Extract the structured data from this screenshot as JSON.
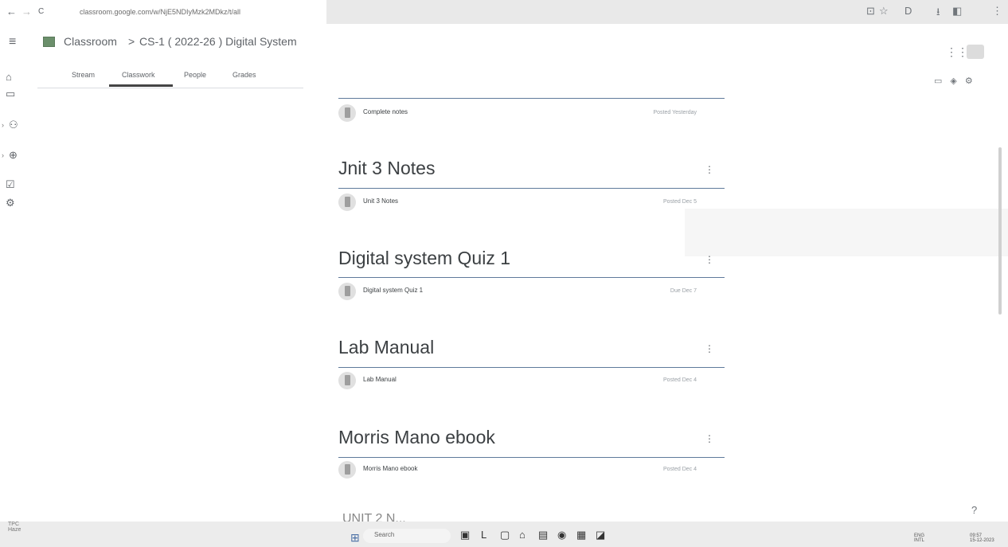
{
  "browser": {
    "back": "←",
    "forward": "→",
    "reload": "C",
    "url": "classroom.google.com/w/NjE5NDIyMzk2MDkz/t/all",
    "extensions": [
      "⊡",
      "☆",
      "D",
      "⭳",
      "◧",
      "⋮"
    ]
  },
  "header": {
    "menu": "≡",
    "app_name": "Classroom",
    "separator": ">",
    "class_name": "CS-1 ( 2022-26 ) Digital System",
    "apps": "⋮⋮"
  },
  "rail": {
    "home": "⌂",
    "calendar": "▭",
    "enrolled": "⚇",
    "teaching": "⊕",
    "todo": "☑",
    "settings": "⚙",
    "caret": "›"
  },
  "tabs": [
    "Stream",
    "Classwork",
    "People",
    "Grades"
  ],
  "tab_active": "Classwork",
  "toolbar": {
    "calendar": "▭",
    "drive": "◈",
    "settings": "⚙"
  },
  "items": {
    "complete": {
      "title": "Complete notes",
      "meta": "Posted Yesterday"
    },
    "unit3": {
      "title": "Unit 3 Notes",
      "meta": "Posted Dec 5"
    },
    "quiz": {
      "title": "Digital system Quiz 1",
      "meta": "Due Dec 7"
    },
    "lab": {
      "title": "Lab Manual",
      "meta": "Posted Dec 4"
    },
    "ebook": {
      "title": "Morris Mano ebook",
      "meta": "Posted Dec 4"
    }
  },
  "topics": {
    "unit3": "Jnit 3 Notes",
    "quiz": "Digital system Quiz 1",
    "lab": "Lab Manual",
    "ebook": "Morris Mano ebook",
    "partial": "UNIT 2 N..."
  },
  "more": "⋮",
  "help": "?",
  "weather": {
    "temp": "TPC",
    "label": "Haze"
  },
  "taskbar": {
    "start": "⊞",
    "search": "Search",
    "apps": [
      "▣",
      "L",
      "▢",
      "⌂",
      "▤",
      "◉",
      "▦",
      "◪"
    ],
    "lang": "ENG",
    "region": "INTL",
    "time": "09:57",
    "date": "15-12-2023"
  }
}
